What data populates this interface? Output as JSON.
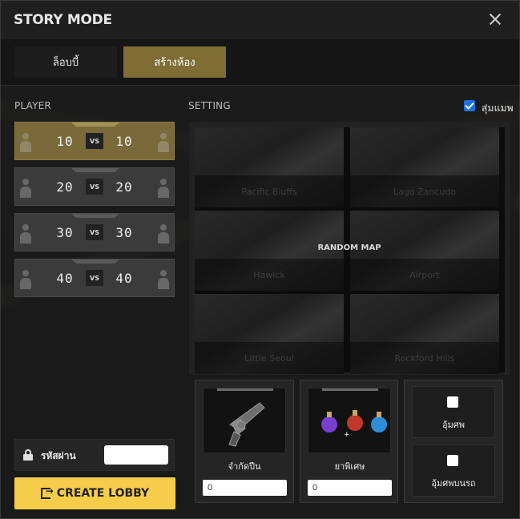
{
  "window": {
    "title": "STORY MODE"
  },
  "tabs": [
    {
      "label": "ล็อบบี้",
      "active": false
    },
    {
      "label": "สร้างห้อง",
      "active": true
    }
  ],
  "player": {
    "label": "PLAYER",
    "options": [
      {
        "left": "10",
        "vs": "VS",
        "right": "10",
        "selected": true
      },
      {
        "left": "20",
        "vs": "VS",
        "right": "20",
        "selected": false
      },
      {
        "left": "30",
        "vs": "VS",
        "right": "30",
        "selected": false
      },
      {
        "left": "40",
        "vs": "VS",
        "right": "40",
        "selected": false
      }
    ]
  },
  "setting": {
    "label": "SETTING",
    "random_label": "สุ่มแมพ",
    "random_checked": true,
    "random_map_text": "RANDOM MAP",
    "maps": [
      "Pacific Bluffs",
      "Lago Zancudo",
      "Hawick",
      "Airport",
      "Little Seoul",
      "Rockford Hills"
    ]
  },
  "options": {
    "gun_limit": {
      "label": "จำกัดปืน",
      "value": "0"
    },
    "potion": {
      "label": "ยาพิเศษ",
      "value": "0"
    },
    "checks": [
      {
        "label": "อุ้มศพ",
        "checked": false
      },
      {
        "label": "อุ้มศพบนรถ",
        "checked": false
      }
    ]
  },
  "password": {
    "label": "รหัสผ่าน",
    "value": ""
  },
  "create_button": {
    "label": "CREATE LOBBY"
  },
  "colors": {
    "accent": "#f6cd4a",
    "selected_tab": "#7f6d35",
    "checkbox": "#1e6fe0"
  }
}
